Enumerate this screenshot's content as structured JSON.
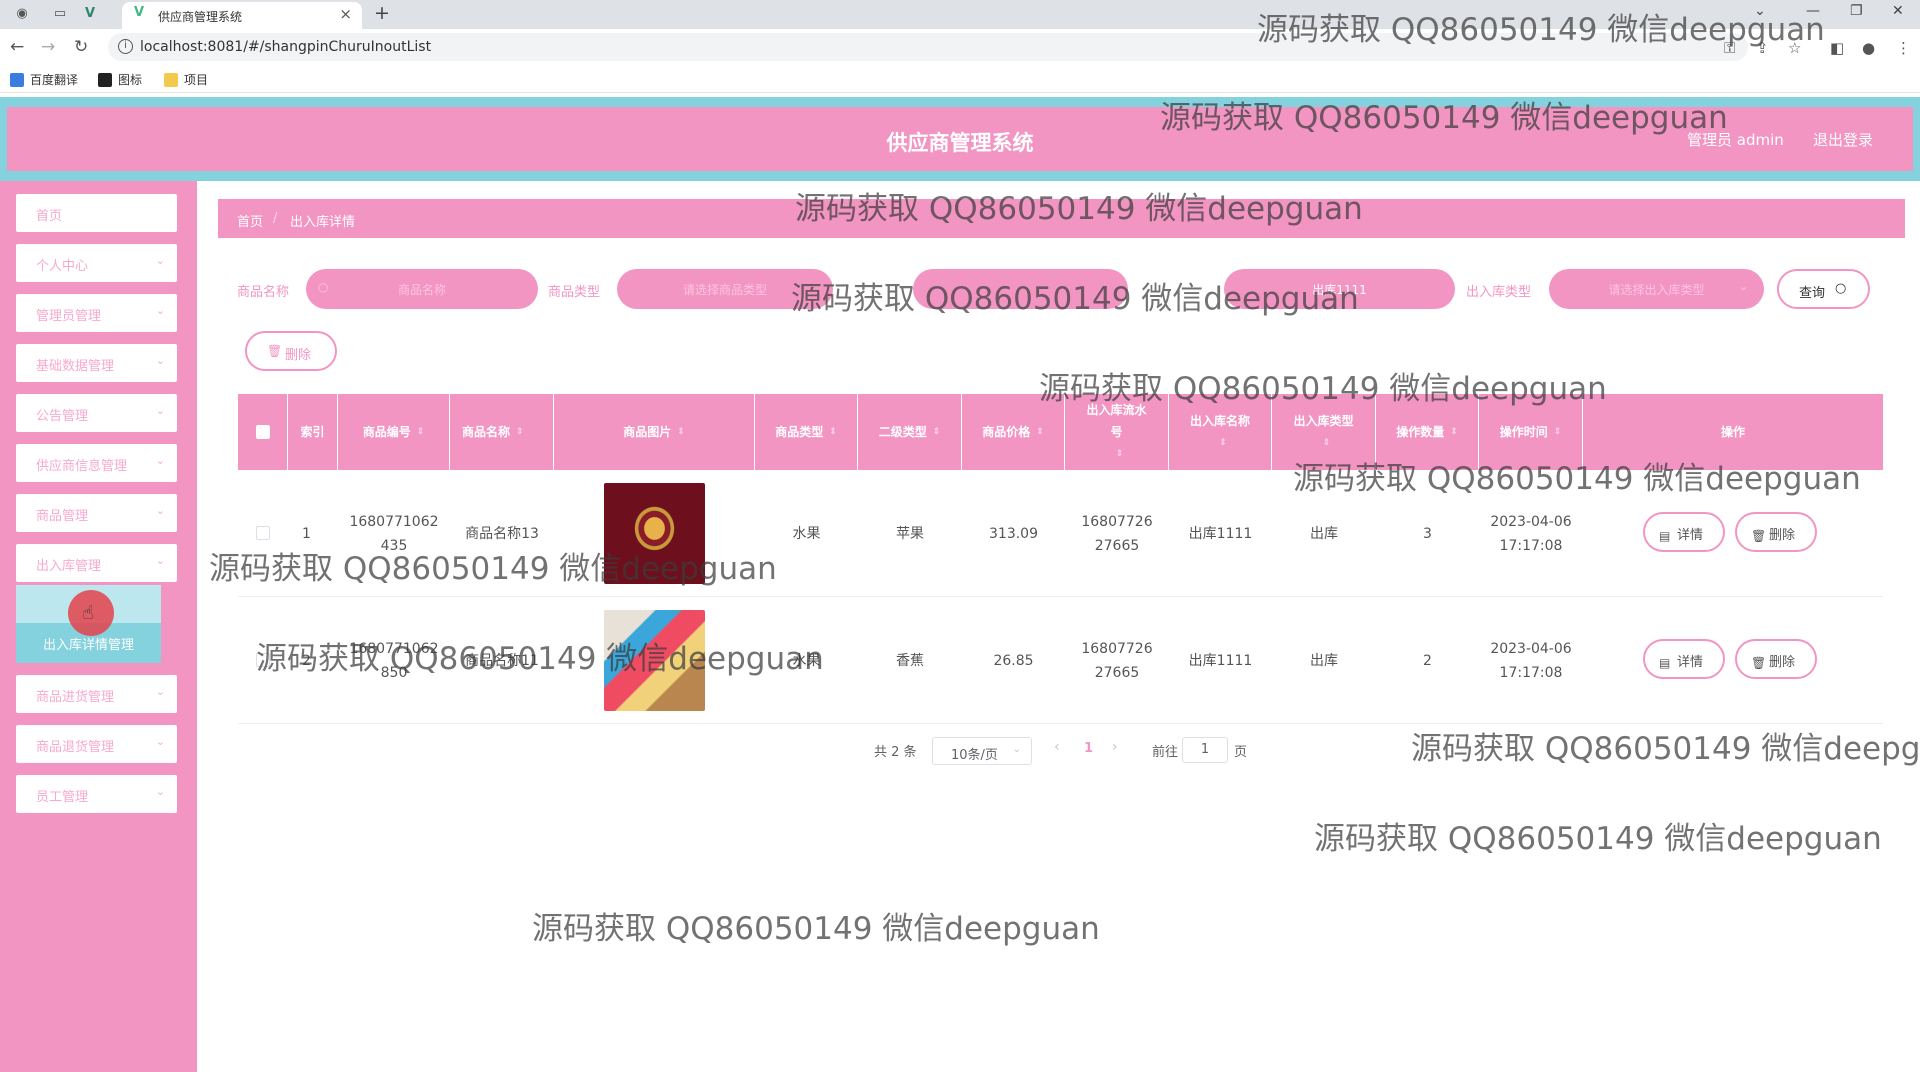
{
  "browser": {
    "tab_title": "供应商管理系统",
    "url": "localhost:8081/#/shangpinChuruInoutList",
    "bookmarks": [
      "百度翻译",
      "图标",
      "项目"
    ]
  },
  "header": {
    "title": "供应商管理系统",
    "user": "管理员 admin",
    "logout": "退出登录"
  },
  "sidebar": {
    "items": [
      {
        "label": "首页",
        "arrow": ""
      },
      {
        "label": "个人中心",
        "arrow": "⌄"
      },
      {
        "label": "管理员管理",
        "arrow": "⌄"
      },
      {
        "label": "基础数据管理",
        "arrow": "⌄"
      },
      {
        "label": "公告管理",
        "arrow": "⌄"
      },
      {
        "label": "供应商信息管理",
        "arrow": "⌄"
      },
      {
        "label": "商品管理",
        "arrow": "⌄"
      },
      {
        "label": "出入库管理",
        "arrow": "⌄"
      }
    ],
    "active_sub": "出入库详情管理",
    "items_after": [
      {
        "label": "商品进货管理",
        "arrow": "⌄"
      },
      {
        "label": "商品退货管理",
        "arrow": "⌄"
      },
      {
        "label": "员工管理",
        "arrow": "⌄"
      }
    ]
  },
  "breadcrumb": {
    "home": "首页",
    "sep": "/",
    "current": "出入库详情"
  },
  "filters": {
    "name_label": "商品名称",
    "name_placeholder": "商品名称",
    "type_label": "商品类型",
    "type_placeholder": "请选择商品类型",
    "inout_name_value": "出库1111",
    "inout_type_label": "出入库类型",
    "inout_type_placeholder": "请选择出入库类型",
    "search_button": "查询",
    "delete_button": "删除"
  },
  "table": {
    "columns": [
      "索引",
      "商品编号",
      "商品名称",
      "商品图片",
      "商品类型",
      "二级类型",
      "商品价格",
      "出入库流水号",
      "出入库名称",
      "出入库类型",
      "操作数量",
      "操作时间",
      "操作"
    ],
    "rows": [
      {
        "index": "1",
        "code": "1680771062435",
        "name": "商品名称13",
        "type": "水果",
        "subtype": "苹果",
        "price": "313.09",
        "serial": "1680772627665",
        "inout_name": "出库1111",
        "inout_type": "出库",
        "qty": "3",
        "time_date": "2023-04-06",
        "time_clock": "17:17:08"
      },
      {
        "index": "2",
        "code": "1680771062850",
        "name": "商品名称11",
        "type": "水果",
        "subtype": "香蕉",
        "price": "26.85",
        "serial": "1680772627665",
        "inout_name": "出库1111",
        "inout_type": "出库",
        "qty": "2",
        "time_date": "2023-04-06",
        "time_clock": "17:17:08"
      }
    ],
    "detail_button": "详情",
    "delete_button": "删除"
  },
  "pagination": {
    "total": "共 2 条",
    "page_size": "10条/页",
    "current": "1",
    "goto_label": "前往",
    "goto_value": "1",
    "page_suffix": "页"
  },
  "watermark": "源码获取 QQ86050149 微信deepguan",
  "colors": {
    "accent": "#f295c3",
    "frame": "#83d2dd"
  }
}
